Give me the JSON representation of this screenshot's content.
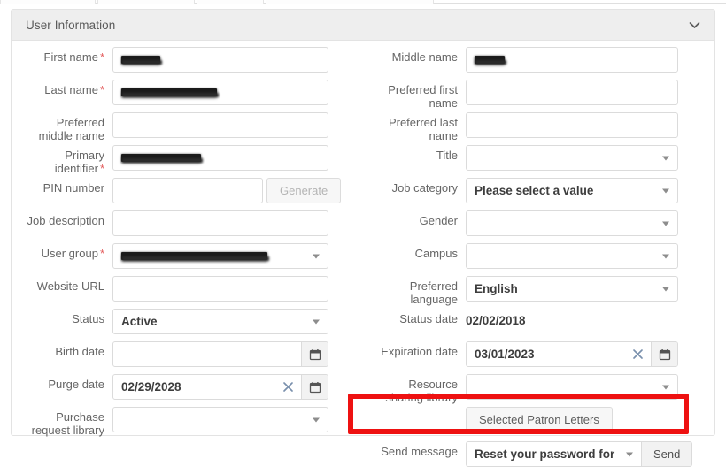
{
  "panel": {
    "title": "User Information",
    "collapse_icon": "chevron-down-icon"
  },
  "left_column": [
    {
      "label": "First name",
      "required": true,
      "type": "text",
      "value": "",
      "redacted": true,
      "redact_width": 44
    },
    {
      "label": "Last name",
      "required": true,
      "type": "text",
      "value": "",
      "redacted": true,
      "redact_width": 108
    },
    {
      "label": "Preferred\nmiddle name",
      "required": false,
      "type": "text",
      "value": "",
      "redacted": false
    },
    {
      "label": "Primary\nidentifier",
      "required": true,
      "type": "text",
      "value": "",
      "redacted": true,
      "redact_width": 90
    },
    {
      "label": "PIN number",
      "required": false,
      "type": "text-with-button",
      "value": "",
      "button_label": "Generate",
      "button_disabled": true
    },
    {
      "label": "Job description",
      "required": false,
      "type": "text",
      "value": "",
      "redacted": false
    },
    {
      "label": "User group",
      "required": true,
      "type": "select",
      "value": "",
      "redacted": true,
      "redact_width": 165
    },
    {
      "label": "Website URL",
      "required": false,
      "type": "text",
      "value": "",
      "redacted": false
    },
    {
      "label": "Status",
      "required": false,
      "type": "select",
      "value": "Active"
    },
    {
      "label": "Birth date",
      "required": false,
      "type": "date",
      "value": "",
      "has_clear": false
    },
    {
      "label": "Purge date",
      "required": false,
      "type": "date",
      "value": "02/29/2028",
      "has_clear": true
    },
    {
      "label": "Purchase\nrequest library",
      "required": false,
      "type": "select",
      "value": ""
    }
  ],
  "right_column": [
    {
      "label": "Middle name",
      "required": false,
      "type": "text",
      "value": "",
      "redacted": true,
      "redact_width": 34
    },
    {
      "label": "Preferred first\nname",
      "required": false,
      "type": "text",
      "value": "",
      "redacted": false
    },
    {
      "label": "Preferred last\nname",
      "required": false,
      "type": "text",
      "value": "",
      "redacted": false
    },
    {
      "label": "Title",
      "required": false,
      "type": "select",
      "value": ""
    },
    {
      "label": "Job category",
      "required": false,
      "type": "select",
      "value": "Please select a value"
    },
    {
      "label": "Gender",
      "required": false,
      "type": "select",
      "value": ""
    },
    {
      "label": "Campus",
      "required": false,
      "type": "select",
      "value": ""
    },
    {
      "label": "Preferred\nlanguage",
      "required": false,
      "type": "select",
      "value": "English"
    },
    {
      "label": "Status date",
      "required": false,
      "type": "static",
      "value": "02/02/2018"
    },
    {
      "label": "Expiration date",
      "required": false,
      "type": "date",
      "value": "03/01/2023",
      "has_clear": true
    },
    {
      "label": "Resource\nsharing library",
      "required": false,
      "type": "select",
      "value": ""
    }
  ],
  "patron_letters": {
    "button_label": "Selected Patron Letters"
  },
  "send_message": {
    "label": "Send message",
    "selected_option": "Reset your password for",
    "send_button_label": "Send"
  },
  "icons": {
    "calendar": "calendar-icon",
    "clear": "clear-icon",
    "caret": "chevron-down-icon"
  },
  "colors": {
    "annotation": "#ee1111",
    "required_asterisk": "#e35b5b",
    "panel_header_bg": "#eeeeee",
    "border": "#e3e3e3"
  }
}
